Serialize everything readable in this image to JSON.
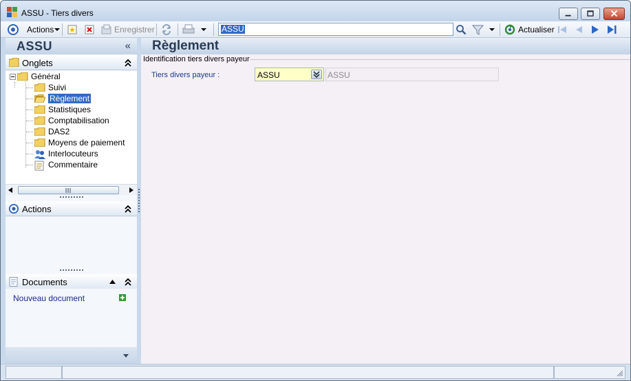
{
  "window": {
    "title": "ASSU -  Tiers divers"
  },
  "toolbar": {
    "actions_label": "Actions",
    "save_label": "Enregistrer",
    "search_value": "ASSU",
    "refresh_label": "Actualiser"
  },
  "left": {
    "header_title": "ASSU",
    "collapse_glyph": "«",
    "onglets": {
      "title": "Onglets",
      "root": "Général",
      "items": [
        {
          "label": "Suivi",
          "icon": "folder-icon"
        },
        {
          "label": "Règlement",
          "icon": "folder-open-icon",
          "selected": true
        },
        {
          "label": "Statistiques",
          "icon": "folder-icon"
        },
        {
          "label": "Comptabilisation",
          "icon": "folder-icon"
        },
        {
          "label": "DAS2",
          "icon": "folder-icon"
        },
        {
          "label": "Moyens de paiement",
          "icon": "folder-icon"
        },
        {
          "label": "Interlocuteurs",
          "icon": "people-icon"
        },
        {
          "label": "Commentaire",
          "icon": "note-icon"
        }
      ]
    },
    "actions": {
      "title": "Actions"
    },
    "documents": {
      "title": "Documents",
      "new_document": "Nouveau document"
    }
  },
  "main": {
    "title": "Règlement",
    "group_title": "Identification tiers divers payeur",
    "field_label": "Tiers divers payeur :",
    "field_value": "ASSU",
    "field_display": "ASSU"
  },
  "colors": {
    "accent": "#316ac5",
    "header_text": "#2a3b55",
    "field_label": "#1a3a8c",
    "combo_bg": "#ffffc8"
  }
}
